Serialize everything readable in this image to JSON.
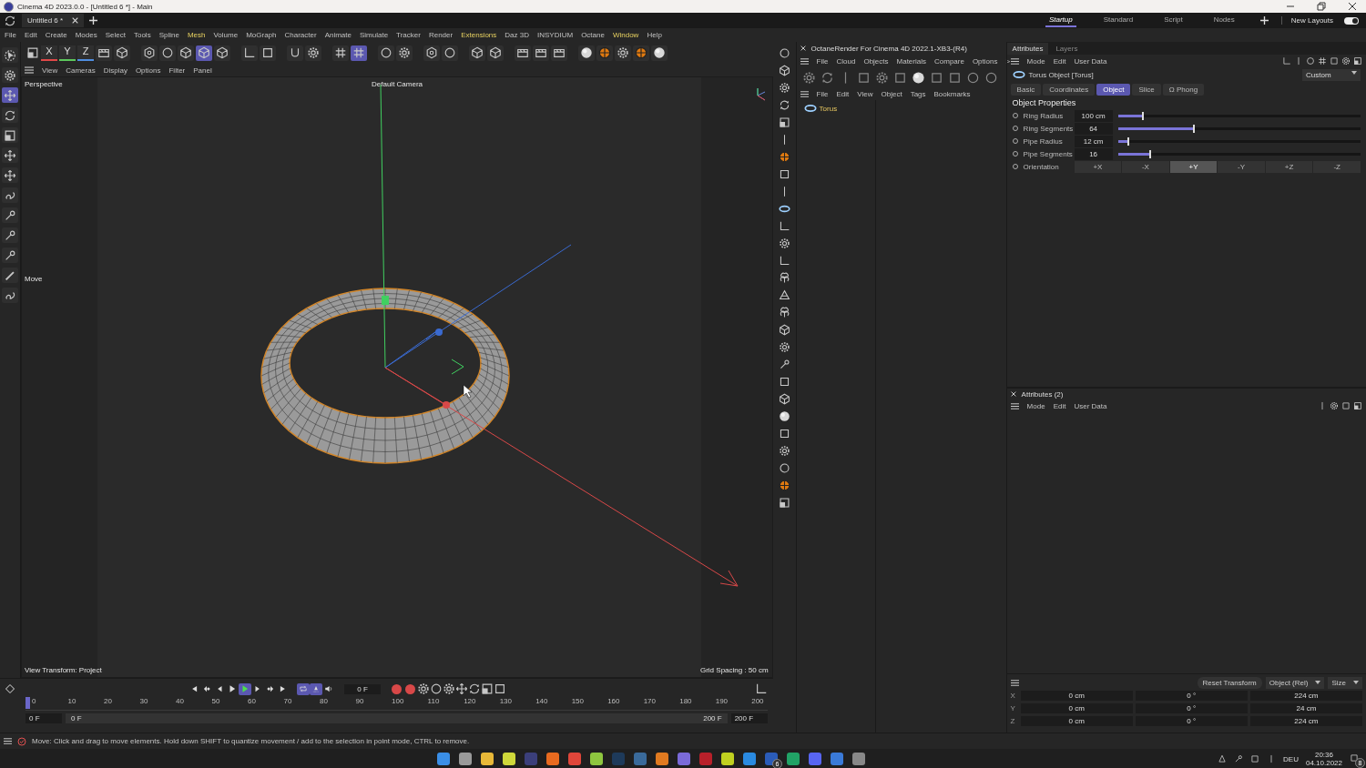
{
  "title_bar": {
    "title": "Cinema 4D 2023.0.0 - [Untitled 6 *] - Main"
  },
  "tabs": [
    {
      "label": "Untitled 6 *",
      "selected": true
    }
  ],
  "layouts": [
    {
      "label": "Startup",
      "selected": true
    },
    {
      "label": "Standard",
      "selected": false
    },
    {
      "label": "Script",
      "selected": false
    },
    {
      "label": "Nodes",
      "selected": false
    }
  ],
  "new_layouts": {
    "label": "New Layouts",
    "on": true
  },
  "menu": [
    {
      "label": "File",
      "highlighted": false
    },
    {
      "label": "Edit",
      "highlighted": false
    },
    {
      "label": "Create",
      "highlighted": false
    },
    {
      "label": "Modes",
      "highlighted": false
    },
    {
      "label": "Select",
      "highlighted": false
    },
    {
      "label": "Tools",
      "highlighted": false
    },
    {
      "label": "Spline",
      "highlighted": false
    },
    {
      "label": "Mesh",
      "highlighted": true
    },
    {
      "label": "Volume",
      "highlighted": false
    },
    {
      "label": "MoGraph",
      "highlighted": false
    },
    {
      "label": "Character",
      "highlighted": false
    },
    {
      "label": "Animate",
      "highlighted": false
    },
    {
      "label": "Simulate",
      "highlighted": false
    },
    {
      "label": "Tracker",
      "highlighted": false
    },
    {
      "label": "Render",
      "highlighted": false
    },
    {
      "label": "Extensions",
      "highlighted": true
    },
    {
      "label": "Daz 3D",
      "highlighted": false
    },
    {
      "label": "INSYDIUM",
      "highlighted": false
    },
    {
      "label": "Octane",
      "highlighted": false
    },
    {
      "label": "Window",
      "highlighted": true
    },
    {
      "label": "Help",
      "highlighted": false
    }
  ],
  "axis_locks": [
    {
      "label": "X",
      "color": "#e04848"
    },
    {
      "label": "Y",
      "color": "#5cc85c"
    },
    {
      "label": "Z",
      "color": "#4f8de0"
    }
  ],
  "toolbar_buttons": [
    {
      "selected": false
    },
    {
      "selected": false
    },
    {
      "selected": false
    },
    {
      "selected": false
    },
    {
      "selected": false
    },
    {
      "selected": true
    },
    {
      "selected": false
    },
    {
      "selected": false
    },
    {
      "selected": false
    },
    {
      "selected": false
    },
    {
      "selected": false
    },
    {
      "selected": false
    },
    {
      "selected": true
    },
    {
      "selected": false
    },
    {
      "selected": false
    },
    {
      "selected": false
    },
    {
      "selected": false
    },
    {
      "selected": false
    },
    {
      "selected": false
    },
    {
      "selected": false
    },
    {
      "selected": false
    },
    {
      "selected": false
    },
    {
      "selected": false
    },
    {
      "selected": false
    },
    {
      "selected": false
    },
    {
      "selected": false
    },
    {
      "selected": false
    }
  ],
  "tools": [
    {
      "selected": false
    },
    {
      "selected": false
    },
    {
      "selected": true
    },
    {
      "selected": false
    },
    {
      "selected": false
    },
    {
      "selected": false
    },
    {
      "selected": false
    },
    {
      "selected": false
    },
    {
      "selected": false
    },
    {
      "selected": false
    },
    {
      "selected": false
    },
    {
      "selected": false
    },
    {
      "selected": false
    }
  ],
  "viewport": {
    "menu": [
      "View",
      "Cameras",
      "Display",
      "Options",
      "Filter",
      "Panel"
    ],
    "camera": "Perspective",
    "camera_label": "Default Camera",
    "tool_label": "Move",
    "view_transform": "View Transform: Project",
    "grid_spacing": "Grid Spacing : 50 cm"
  },
  "timeline": {
    "buttons": [
      {
        "selected": false
      },
      {
        "selected": false
      },
      {
        "selected": false
      },
      {
        "selected": false
      },
      {
        "selected": true
      },
      {
        "selected": false
      },
      {
        "selected": false
      },
      {
        "selected": false
      },
      {
        "selected": true
      },
      {
        "selected": true
      },
      {
        "selected": false
      }
    ],
    "current_frame": "0 F",
    "ticks": [
      "0",
      "10",
      "20",
      "30",
      "40",
      "50",
      "60",
      "70",
      "80",
      "90",
      "100",
      "110",
      "120",
      "130",
      "140",
      "150",
      "160",
      "170",
      "180",
      "190",
      "200"
    ],
    "start": "0 F",
    "range": {
      "level": 1
    },
    "range_start": "0 F",
    "range_end": "200 F",
    "end": "200 F"
  },
  "octane": {
    "title": "OctaneRender For Cinema 4D 2022.1-XB3-(R4)",
    "menu": [
      "File",
      "Cloud",
      "Objects",
      "Materials",
      "Compare",
      "Options",
      ">"
    ]
  },
  "object_manager": {
    "menu": [
      "File",
      "Edit",
      "View",
      "Object",
      "Tags",
      "Bookmarks"
    ],
    "objects": [
      {
        "name": "Torus"
      }
    ]
  },
  "attributes": {
    "tabs": [
      {
        "label": "Attributes",
        "selected": true
      },
      {
        "label": "Layers",
        "selected": false
      }
    ],
    "menu": [
      "Mode",
      "Edit",
      "User Data"
    ],
    "object_title": "Torus Object [Torus]",
    "preset": "Custom",
    "pages": [
      {
        "label": "Basic",
        "selected": false
      },
      {
        "label": "Coordinates",
        "selected": false
      },
      {
        "label": "Object",
        "selected": true
      },
      {
        "label": "Slice",
        "selected": false
      },
      {
        "label": "Ω Phong",
        "selected": false
      }
    ],
    "section": "Object Properties",
    "params": [
      {
        "label": "Ring Radius",
        "value": "100 cm",
        "level": 0.1
      },
      {
        "label": "Ring Segments",
        "value": "64",
        "level": 0.31
      },
      {
        "label": "Pipe Radius",
        "value": "12 cm",
        "level": 0.04
      },
      {
        "label": "Pipe Segments",
        "value": "16",
        "level": 0.13
      }
    ],
    "orientation": {
      "label": "Orientation",
      "options": [
        {
          "label": "+X",
          "selected": false
        },
        {
          "label": "-X",
          "selected": false
        },
        {
          "label": "+Y",
          "selected": true
        },
        {
          "label": "-Y",
          "selected": false
        },
        {
          "label": "+Z",
          "selected": false
        },
        {
          "label": "-Z",
          "selected": false
        }
      ]
    }
  },
  "attributes2": {
    "title": "Attributes (2)",
    "menu": [
      "Mode",
      "Edit",
      "User Data"
    ]
  },
  "coordinates": {
    "reset": "Reset Transform",
    "mode": "Object (Rel)",
    "size_mode": "Size",
    "rows": [
      {
        "axis": "X",
        "position": "0 cm",
        "rotation": "0 °",
        "size": "224 cm"
      },
      {
        "axis": "Y",
        "position": "0 cm",
        "rotation": "0 °",
        "size": "24 cm"
      },
      {
        "axis": "Z",
        "position": "0 cm",
        "rotation": "0 °",
        "size": "224 cm"
      }
    ]
  },
  "status_bar": {
    "message": "Move: Click and drag to move elements. Hold down SHIFT to quantize movement / add to the selection in point mode, CTRL to remove."
  },
  "taskbar": {
    "app_badge": "6",
    "language": "DEU",
    "time": "20:36",
    "date": "04.10.2022",
    "notification_badge": "8"
  }
}
